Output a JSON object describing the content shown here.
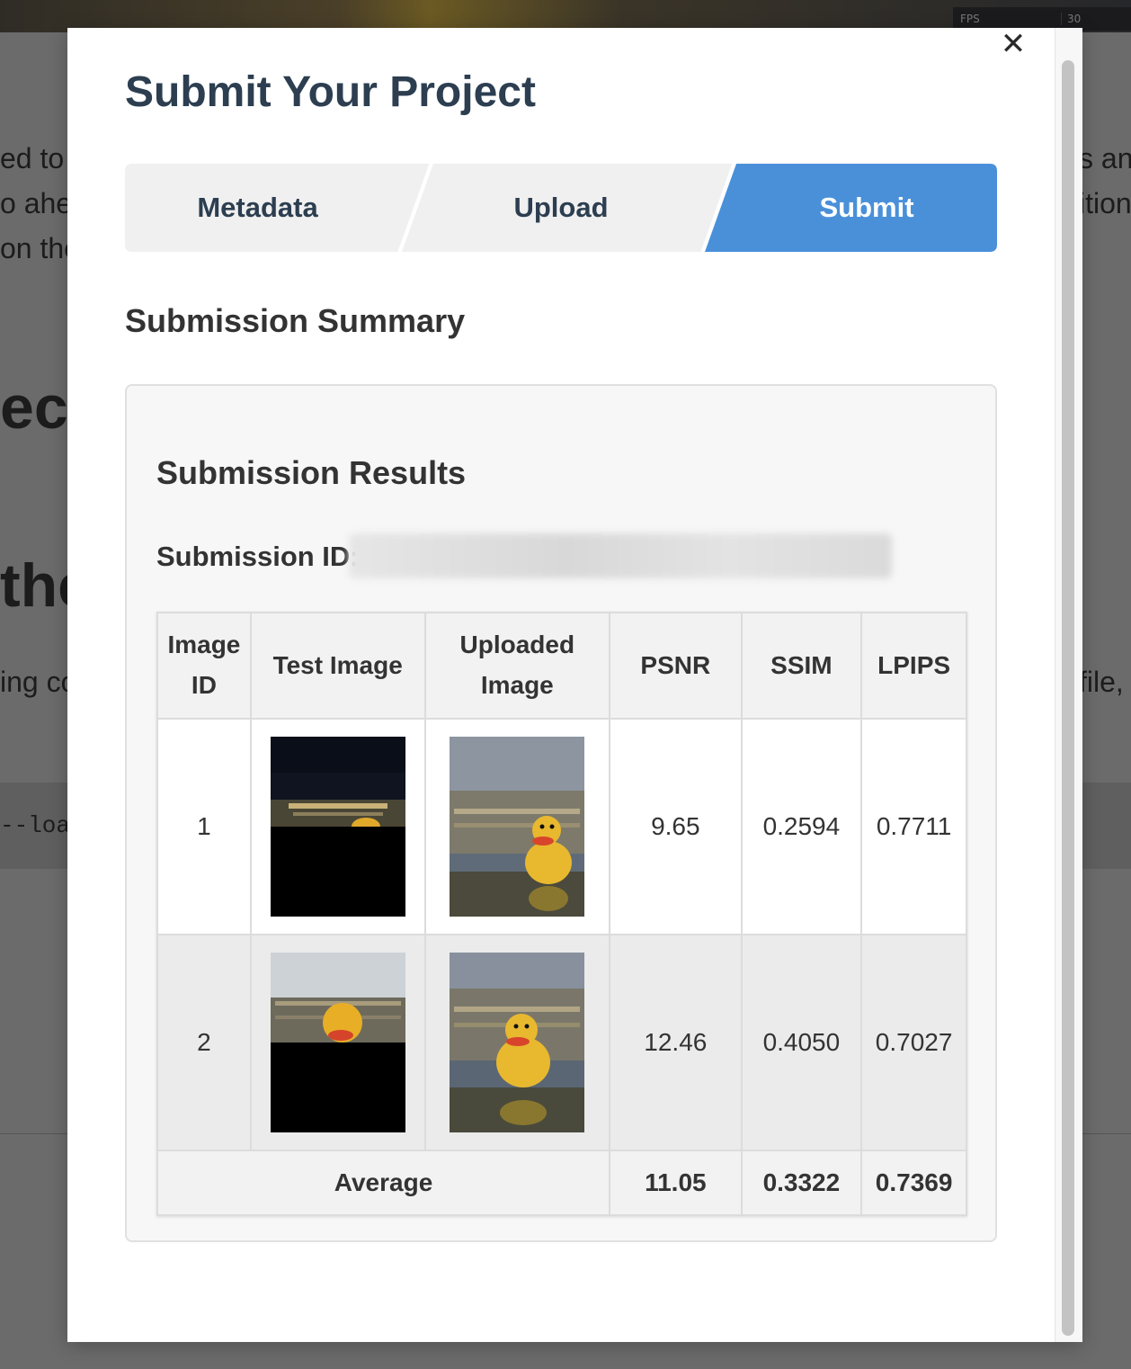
{
  "background": {
    "fps": {
      "label": "FPS",
      "value": "30"
    },
    "left_text_lines": [
      "ed to p",
      "o ahea",
      "on the"
    ],
    "right_text_lines": [
      "s an",
      "ition",
      ""
    ],
    "heading_fragments": [
      "ect",
      "the"
    ],
    "body_fragment_left": "ing co",
    "body_fragment_right": "file, p",
    "code_fragment": "--loa"
  },
  "modal": {
    "close_symbol": "✕",
    "title": "Submit Your Project",
    "steps": [
      {
        "label": "Metadata",
        "active": false
      },
      {
        "label": "Upload",
        "active": false
      },
      {
        "label": "Submit",
        "active": true
      }
    ],
    "colors": {
      "active_step": "#4a90d9",
      "inactive_step": "#f0f0f0",
      "title": "#2c3e50"
    },
    "summary_title": "Submission Summary",
    "results": {
      "title": "Submission Results",
      "submission_id_label": "Submission ID:",
      "columns": [
        "Image ID",
        "Test Image",
        "Uploaded Image",
        "PSNR",
        "SSIM",
        "LPIPS"
      ],
      "rows": [
        {
          "id": "1",
          "test_image": "night-building-duck-icon",
          "uploaded_image": "duck-reconstruction-icon",
          "psnr": "9.65",
          "ssim": "0.2594",
          "lpips": "0.7711"
        },
        {
          "id": "2",
          "test_image": "day-building-duck-icon",
          "uploaded_image": "duck-reconstruction-icon",
          "psnr": "12.46",
          "ssim": "0.4050",
          "lpips": "0.7027"
        }
      ],
      "average": {
        "label": "Average",
        "psnr": "11.05",
        "ssim": "0.3322",
        "lpips": "0.7369"
      }
    }
  }
}
